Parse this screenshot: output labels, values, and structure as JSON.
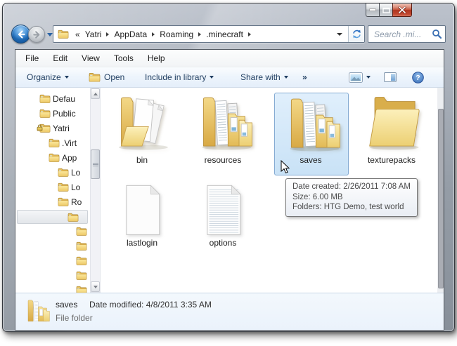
{
  "window": {
    "search_placeholder": "Search .mi...",
    "breadcrumb": {
      "overflow": "«",
      "crumbs": [
        "Yatri",
        "AppData",
        "Roaming",
        ".minecraft"
      ]
    }
  },
  "menubar": {
    "items": [
      "File",
      "Edit",
      "View",
      "Tools",
      "Help"
    ]
  },
  "toolbar": {
    "organize": "Organize",
    "open": "Open",
    "include": "Include in library",
    "share": "Share with",
    "overflow": "»"
  },
  "sidebar": {
    "items": [
      {
        "label": "Defau",
        "depth": 0,
        "icon": "folder-icon"
      },
      {
        "label": "Public",
        "depth": 0,
        "icon": "folder-icon"
      },
      {
        "label": "Yatri",
        "depth": 0,
        "icon": "folder-lock-icon",
        "lock": true
      },
      {
        "label": ".Virt",
        "depth": 1,
        "icon": "folder-icon"
      },
      {
        "label": "App",
        "depth": 1,
        "icon": "folder-icon"
      },
      {
        "label": "Lo",
        "depth": 2,
        "icon": "folder-icon"
      },
      {
        "label": "Lo",
        "depth": 2,
        "icon": "folder-icon"
      },
      {
        "label": "Ro",
        "depth": 2,
        "icon": "folder-icon"
      },
      {
        "label": "",
        "depth": 3,
        "icon": "folder-icon",
        "selected": true
      },
      {
        "label": "",
        "depth": 4,
        "icon": "folder-icon"
      },
      {
        "label": "",
        "depth": 4,
        "icon": "folder-icon"
      },
      {
        "label": "",
        "depth": 4,
        "icon": "folder-icon"
      },
      {
        "label": "",
        "depth": 4,
        "icon": "folder-icon"
      },
      {
        "label": "",
        "depth": 4,
        "icon": "folder-icon"
      }
    ]
  },
  "files": {
    "items": [
      {
        "name": "bin",
        "icon": "folder-documents-icon"
      },
      {
        "name": "resources",
        "icon": "folder-files-icon"
      },
      {
        "name": "saves",
        "icon": "folder-files-icon",
        "selected": true
      },
      {
        "name": "texturepacks",
        "icon": "folder-plain-icon"
      },
      {
        "name": "lastlogin",
        "icon": "file-blank-icon"
      },
      {
        "name": "options",
        "icon": "file-text-icon"
      }
    ]
  },
  "tooltip": {
    "lines": [
      "Date created: 2/26/2011 7:08 AM",
      "Size: 6.00 MB",
      "Folders: HTG Demo, test world"
    ]
  },
  "details": {
    "name": "saves",
    "type": "File folder",
    "modified": "Date modified:  4/8/2011 3:35 AM"
  }
}
